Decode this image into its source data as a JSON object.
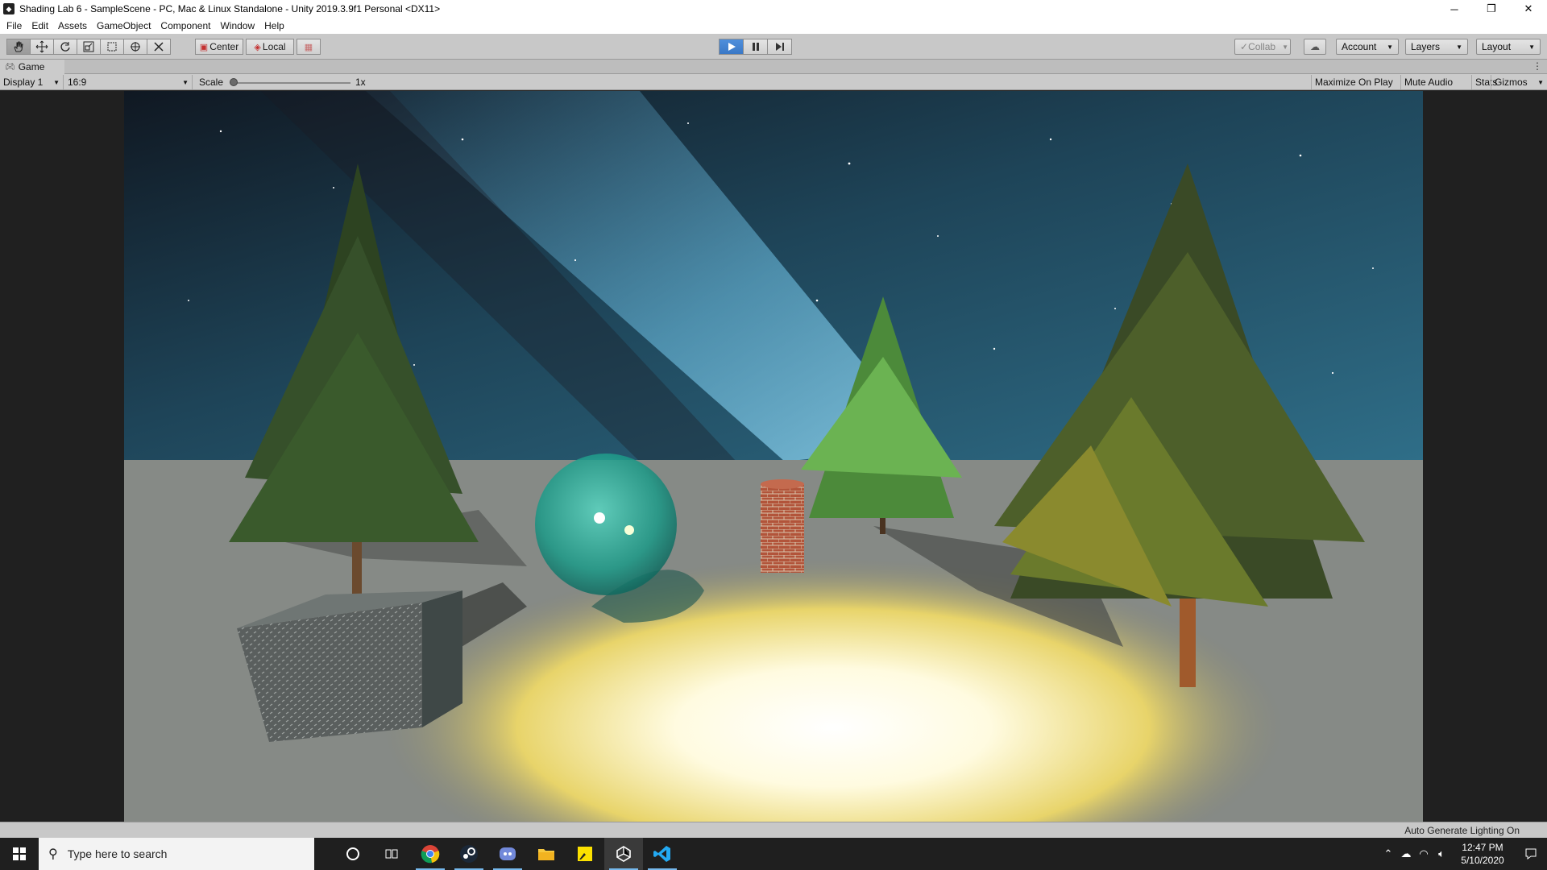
{
  "window": {
    "title": "Shading Lab 6 - SampleScene - PC, Mac & Linux Standalone - Unity 2019.3.9f1 Personal <DX11>",
    "minimize": "─",
    "restore": "❐",
    "close": "✕"
  },
  "menu": [
    "File",
    "Edit",
    "Assets",
    "GameObject",
    "Component",
    "Window",
    "Help"
  ],
  "toolbar": {
    "pivot_label": "Center",
    "space_label": "Local",
    "collab_label": "Collab",
    "account_label": "Account",
    "layers_label": "Layers",
    "layout_label": "Layout"
  },
  "tab": {
    "label": "Game"
  },
  "game_bar": {
    "display": "Display 1",
    "aspect": "16:9",
    "scale_label": "Scale",
    "scale_value": "1x",
    "scale_level": 0.0,
    "maximize_on_play": "Maximize On Play",
    "mute_audio": "Mute Audio",
    "stats": "Stats",
    "gizmos": "Gizmos"
  },
  "status": {
    "text": "Auto Generate Lighting On"
  },
  "taskbar": {
    "search_placeholder": "Type here to search",
    "time": "12:47 PM",
    "date": "5/10/2020",
    "apps": [
      "task-view-icon",
      "chrome-icon",
      "steam-icon",
      "discord-icon",
      "file-explorer-icon",
      "sticky-notes-icon",
      "unity-icon",
      "vscode-icon"
    ]
  },
  "colors": {
    "unity_toolbar": "#c8c8c8",
    "play_active": "#3a78c6",
    "taskbar": "#1f1f1f",
    "taskbar_running": "#76b9ed"
  }
}
